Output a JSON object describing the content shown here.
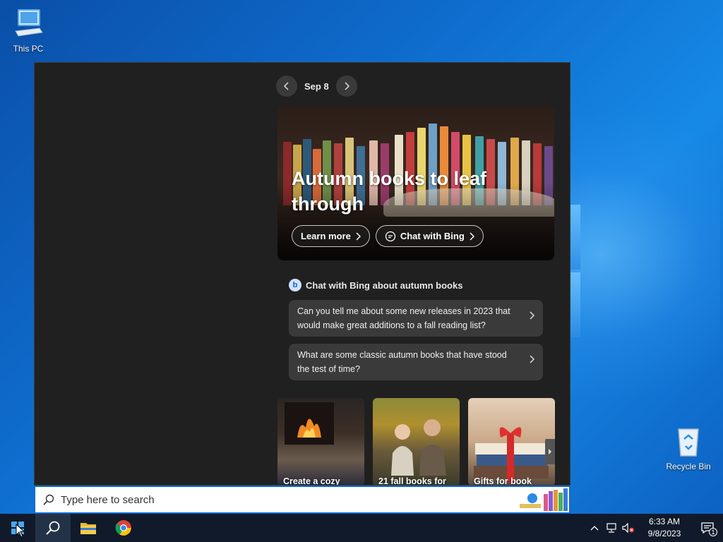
{
  "desktop": {
    "icons": [
      {
        "label": "This PC",
        "icon": "computer-icon"
      },
      {
        "label": "Recycle Bin",
        "icon": "recycle-bin-icon"
      }
    ]
  },
  "search_panel": {
    "date_nav": {
      "date": "Sep 8",
      "prev_icon": "chevron-left-icon",
      "next_icon": "chevron-right-icon"
    },
    "hero": {
      "title": "Autumn books to leaf through",
      "learn_more": "Learn more",
      "chat_with_bing": "Chat with Bing"
    },
    "chat": {
      "heading": "Chat with Bing about autumn books",
      "prompts": [
        "Can you tell me about some new releases in 2023 that would make great additions to a fall reading list?",
        "What are some classic autumn books that have stood the test of time?"
      ]
    },
    "thumbnails": [
      {
        "caption": "Create a cozy"
      },
      {
        "caption": "21 fall books for"
      },
      {
        "caption": "Gifts for book"
      }
    ]
  },
  "search_box": {
    "placeholder": "Type here to search",
    "icon": "search-icon"
  },
  "taskbar": {
    "apps": [
      {
        "name": "Start",
        "icon": "windows-start-icon"
      },
      {
        "name": "Search",
        "icon": "search-icon"
      },
      {
        "name": "File Explorer",
        "icon": "folder-icon"
      },
      {
        "name": "Google Chrome",
        "icon": "chrome-icon"
      }
    ],
    "tray": {
      "time": "6:33 AM",
      "date": "9/8/2023",
      "notification_count": "1"
    }
  },
  "colors": {
    "accent": "#0a6bd1",
    "panel_bg": "#202020",
    "card_bg": "#3a3a3a",
    "taskbar_bg": "#101a2a"
  }
}
